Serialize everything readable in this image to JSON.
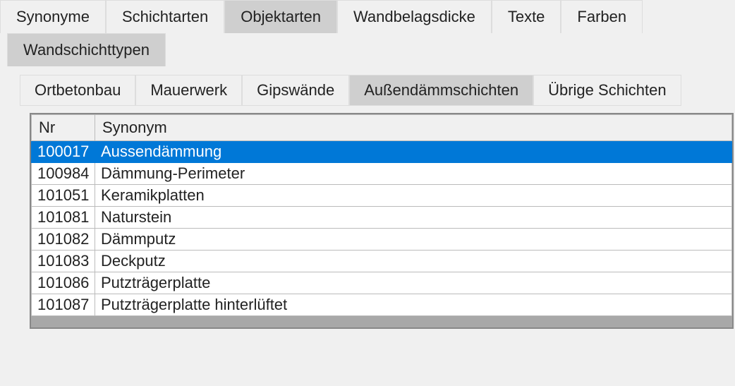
{
  "tabs_level1": [
    {
      "label": "Synonyme",
      "active": false
    },
    {
      "label": "Schichtarten",
      "active": false
    },
    {
      "label": "Objektarten",
      "active": true
    },
    {
      "label": "Wandbelagsdicke",
      "active": false
    },
    {
      "label": "Texte",
      "active": false
    },
    {
      "label": "Farben",
      "active": false
    }
  ],
  "tabs_level2": [
    {
      "label": "Wandschichttypen",
      "active": true
    }
  ],
  "tabs_level3": [
    {
      "label": "Ortbetonbau",
      "active": false
    },
    {
      "label": "Mauerwerk",
      "active": false
    },
    {
      "label": "Gipswände",
      "active": false
    },
    {
      "label": "Außendämmschichten",
      "active": true
    },
    {
      "label": "Übrige Schichten",
      "active": false
    }
  ],
  "table": {
    "headers": {
      "nr": "Nr",
      "synonym": "Synonym"
    },
    "rows": [
      {
        "nr": "100017",
        "synonym": "Aussendämmung",
        "selected": true
      },
      {
        "nr": "100984",
        "synonym": "Dämmung-Perimeter",
        "selected": false
      },
      {
        "nr": "101051",
        "synonym": "Keramikplatten",
        "selected": false
      },
      {
        "nr": "101081",
        "synonym": "Naturstein",
        "selected": false
      },
      {
        "nr": "101082",
        "synonym": "Dämmputz",
        "selected": false
      },
      {
        "nr": "101083",
        "synonym": "Deckputz",
        "selected": false
      },
      {
        "nr": "101086",
        "synonym": "Putzträgerplatte",
        "selected": false
      },
      {
        "nr": "101087",
        "synonym": "Putzträgerplatte hinterlüftet",
        "selected": false
      }
    ]
  },
  "colors": {
    "selection": "#0078d7",
    "tab_active": "#cfcfcf",
    "background": "#f0f0f0"
  }
}
